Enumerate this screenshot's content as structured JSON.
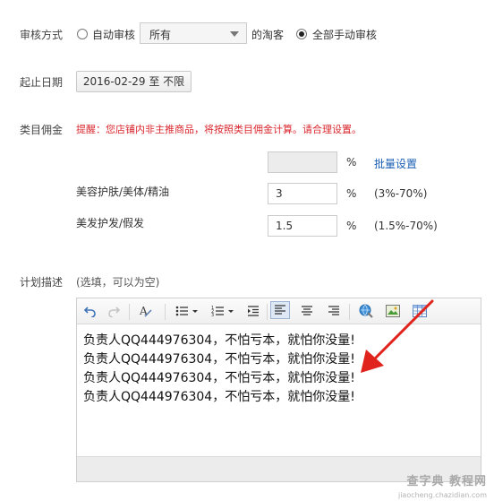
{
  "audit": {
    "label": "审核方式",
    "option_auto": "自动审核",
    "select_value": "所有",
    "suffix": "的淘客",
    "option_manual": "全部手动审核",
    "selected": "manual"
  },
  "date": {
    "label": "起止日期",
    "value": "2016-02-29 至 不限"
  },
  "commission": {
    "label": "类目佣金",
    "notice": "提醒：您店铺内非主推商品，将按照类目佣金计算。请合理设置。",
    "percent_sign": "%",
    "batch_link": "批量设置",
    "rows": [
      {
        "name": "美容护肤/美体/精油",
        "value": "3",
        "range": "(3%-70%)"
      },
      {
        "name": "美发护发/假发",
        "value": "1.5",
        "range": "(1.5%-70%)"
      }
    ]
  },
  "plan": {
    "label": "计划描述",
    "hint": "(选填，可以为空)",
    "lines": [
      "负责人QQ444976304，不怕亏本，就怕你没量!",
      "负责人QQ444976304，不怕亏本，就怕你没量!",
      "负责人QQ444976304，不怕亏本，就怕你没量!",
      "负责人QQ444976304，不怕亏本，就怕你没量!"
    ]
  },
  "watermark": {
    "text": "查字典 教程网",
    "url": "jiaocheng.chazidian.com"
  },
  "colors": {
    "notice_red": "#d9272e",
    "link_blue": "#1a5fb4",
    "arrow_red": "#e0231c"
  }
}
